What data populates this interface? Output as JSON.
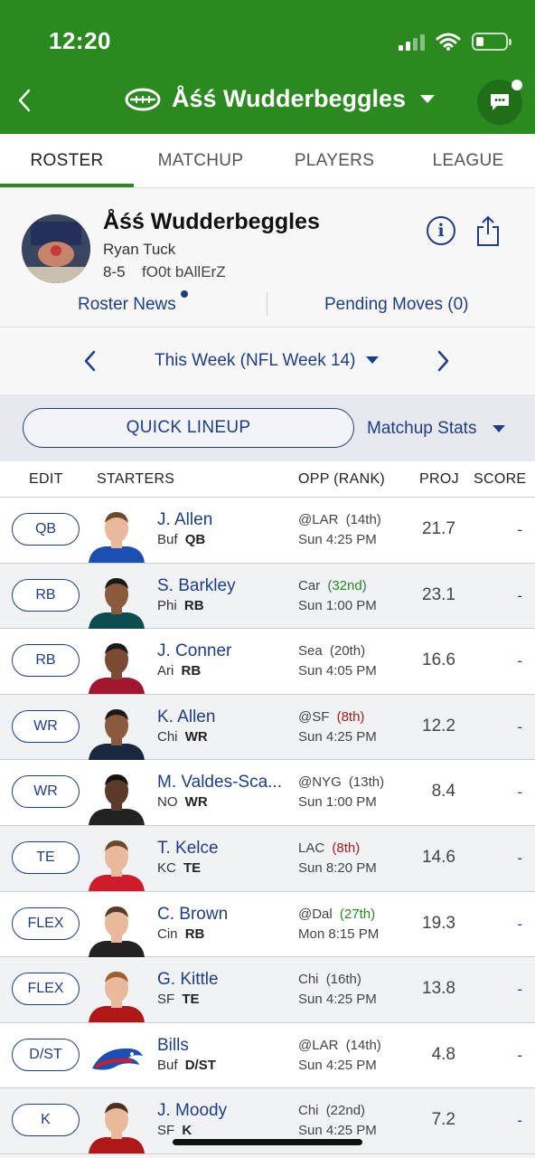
{
  "status_bar": {
    "time": "12:20"
  },
  "header": {
    "title": "Åśś Wudderbeggles",
    "brand_color": "#2a8a1f"
  },
  "tabs": [
    {
      "label": "ROSTER",
      "active": true
    },
    {
      "label": "MATCHUP",
      "active": false
    },
    {
      "label": "PLAYERS",
      "active": false
    },
    {
      "label": "LEAGUE",
      "active": false
    }
  ],
  "team": {
    "name": "Åśś Wudderbeggles",
    "owner": "Ryan Tuck",
    "record": "8-5",
    "league": "fO0t bAllErZ",
    "roster_news": "Roster News",
    "pending_moves": "Pending Moves (0)"
  },
  "week": {
    "label": "This Week (NFL Week 14)"
  },
  "lineup": {
    "quick_lineup": "QUICK LINEUP",
    "matchup_stats": "Matchup Stats"
  },
  "columns": {
    "edit": "EDIT",
    "starters": "STARTERS",
    "opp": "OPP (RANK)",
    "proj": "PROJ",
    "score": "SCORE"
  },
  "players": [
    {
      "slot": "QB",
      "name": "J. Allen",
      "team": "Buf",
      "pos": "QB",
      "opp": "@LAR",
      "rank": "(14th)",
      "rank_type": "neutral",
      "game": "Sun 4:25 PM",
      "proj": "21.7",
      "score": "-",
      "jersey": "#1b4fb3",
      "skin": "#e8b99a",
      "hair": "#6b4a2b"
    },
    {
      "slot": "RB",
      "name": "S. Barkley",
      "team": "Phi",
      "pos": "RB",
      "opp": "Car",
      "rank": "(32nd)",
      "rank_type": "good",
      "game": "Sun 1:00 PM",
      "proj": "23.1",
      "score": "-",
      "jersey": "#0b4d4f",
      "skin": "#8a5a3c",
      "hair": "#1a1a1a"
    },
    {
      "slot": "RB",
      "name": "J. Conner",
      "team": "Ari",
      "pos": "RB",
      "opp": "Sea",
      "rank": "(20th)",
      "rank_type": "neutral",
      "game": "Sun 4:05 PM",
      "proj": "16.6",
      "score": "-",
      "jersey": "#a3162f",
      "skin": "#7a4a33",
      "hair": "#1a1a1a"
    },
    {
      "slot": "WR",
      "name": "K. Allen",
      "team": "Chi",
      "pos": "WR",
      "opp": "@SF",
      "rank": "(8th)",
      "rank_type": "bad",
      "game": "Sun 4:25 PM",
      "proj": "12.2",
      "score": "-",
      "jersey": "#1a2740",
      "skin": "#8a5a3c",
      "hair": "#1a1a1a"
    },
    {
      "slot": "WR",
      "name": "M. Valdes-Sca...",
      "team": "NO",
      "pos": "WR",
      "opp": "@NYG",
      "rank": "(13th)",
      "rank_type": "neutral",
      "game": "Sun 1:00 PM",
      "proj": "8.4",
      "score": "-",
      "jersey": "#222222",
      "skin": "#5a3a28",
      "hair": "#111111"
    },
    {
      "slot": "TE",
      "name": "T. Kelce",
      "team": "KC",
      "pos": "TE",
      "opp": "LAC",
      "rank": "(8th)",
      "rank_type": "bad",
      "game": "Sun 8:20 PM",
      "proj": "14.6",
      "score": "-",
      "jersey": "#d01c2a",
      "skin": "#e8b99a",
      "hair": "#6b4a2b"
    },
    {
      "slot": "FLEX",
      "name": "C. Brown",
      "team": "Cin",
      "pos": "RB",
      "opp": "@Dal",
      "rank": "(27th)",
      "rank_type": "good",
      "game": "Mon 8:15 PM",
      "proj": "19.3",
      "score": "-",
      "jersey": "#222222",
      "skin": "#e8b99a",
      "hair": "#5a3a20"
    },
    {
      "slot": "FLEX",
      "name": "G. Kittle",
      "team": "SF",
      "pos": "TE",
      "opp": "Chi",
      "rank": "(16th)",
      "rank_type": "neutral",
      "game": "Sun 4:25 PM",
      "proj": "13.8",
      "score": "-",
      "jersey": "#b01818",
      "skin": "#e8b99a",
      "hair": "#a0602a"
    },
    {
      "slot": "D/ST",
      "name": "Bills",
      "team": "Buf",
      "pos": "D/ST",
      "opp": "@LAR",
      "rank": "(14th)",
      "rank_type": "neutral",
      "game": "Sun 4:25 PM",
      "proj": "4.8",
      "score": "-",
      "logo": true
    },
    {
      "slot": "K",
      "name": "J. Moody",
      "team": "SF",
      "pos": "K",
      "opp": "Chi",
      "rank": "(22nd)",
      "rank_type": "neutral",
      "game": "Sun 4:25 PM",
      "proj": "7.2",
      "score": "-",
      "jersey": "#b01818",
      "skin": "#e8b99a",
      "hair": "#4a3020"
    }
  ],
  "colors": {
    "link": "#1c3d8c",
    "good": "#228a1e",
    "bad": "#b01818"
  },
  "icons": [
    "back-chevron-icon",
    "football-icon",
    "caret-down-icon",
    "chat-icon",
    "info-icon",
    "share-icon",
    "signal-icon",
    "wifi-icon",
    "battery-icon"
  ]
}
